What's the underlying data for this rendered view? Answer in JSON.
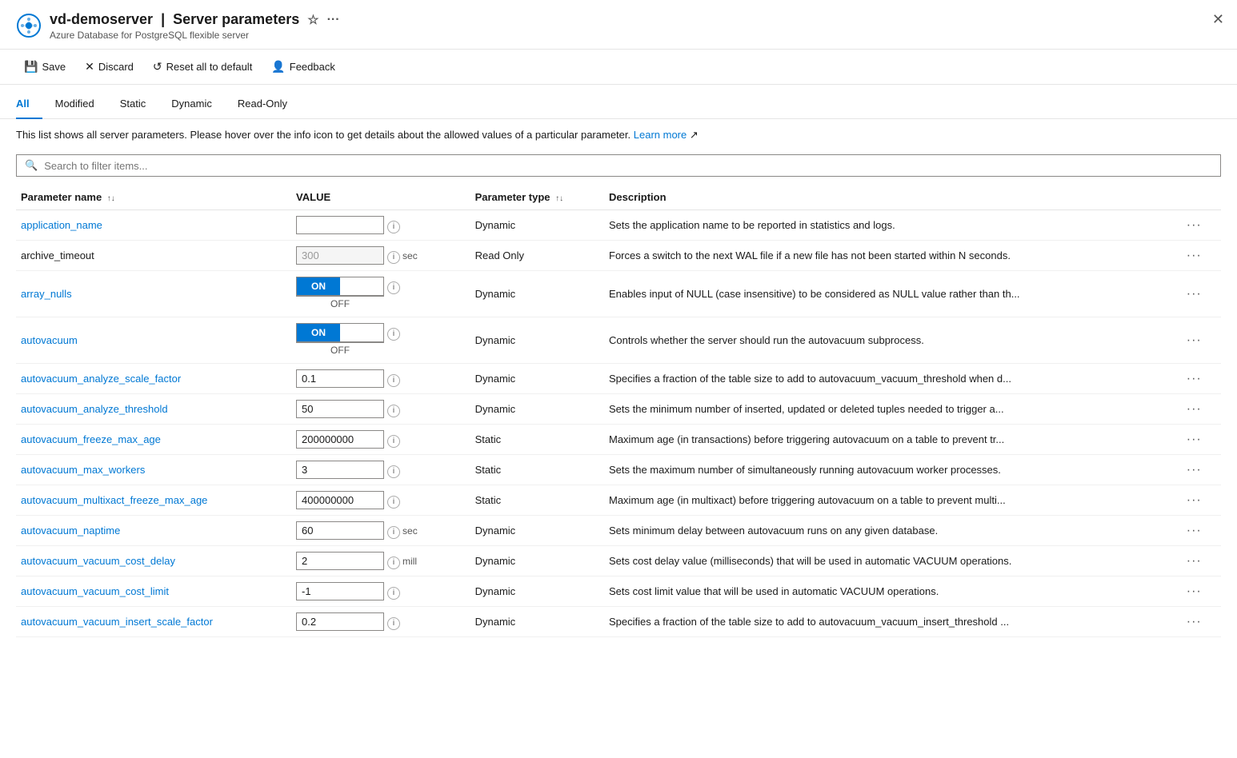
{
  "header": {
    "icon": "gear",
    "server_name": "vd-demoserver",
    "separator": "|",
    "page_title": "Server parameters",
    "subtitle": "Azure Database for PostgreSQL flexible server"
  },
  "toolbar": {
    "save_label": "Save",
    "discard_label": "Discard",
    "reset_label": "Reset all to default",
    "feedback_label": "Feedback"
  },
  "tabs": [
    {
      "id": "all",
      "label": "All",
      "active": true
    },
    {
      "id": "modified",
      "label": "Modified",
      "active": false
    },
    {
      "id": "static",
      "label": "Static",
      "active": false
    },
    {
      "id": "dynamic",
      "label": "Dynamic",
      "active": false
    },
    {
      "id": "readonly",
      "label": "Read-Only",
      "active": false
    }
  ],
  "info_text": "This list shows all server parameters. Please hover over the info icon to get details about the allowed values of a particular parameter.",
  "learn_more": "Learn more",
  "search_placeholder": "Search to filter items...",
  "table": {
    "columns": [
      {
        "id": "param_name",
        "label": "Parameter name",
        "sortable": true
      },
      {
        "id": "value",
        "label": "VALUE",
        "sortable": false
      },
      {
        "id": "param_type",
        "label": "Parameter type",
        "sortable": true
      },
      {
        "id": "description",
        "label": "Description",
        "sortable": false
      }
    ],
    "rows": [
      {
        "name": "application_name",
        "value": "",
        "value_type": "text",
        "unit": "",
        "param_type": "Dynamic",
        "description": "Sets the application name to be reported in statistics and logs."
      },
      {
        "name": "archive_timeout",
        "value": "300",
        "value_type": "text",
        "unit": "sec",
        "disabled": true,
        "param_type": "Read Only",
        "description": "Forces a switch to the next WAL file if a new file has not been started within N seconds."
      },
      {
        "name": "array_nulls",
        "value": "ON",
        "value_type": "toggle",
        "unit": "",
        "param_type": "Dynamic",
        "description": "Enables input of NULL (case insensitive) to be considered as NULL value rather than th..."
      },
      {
        "name": "autovacuum",
        "value": "ON",
        "value_type": "toggle",
        "unit": "",
        "param_type": "Dynamic",
        "description": "Controls whether the server should run the autovacuum subprocess."
      },
      {
        "name": "autovacuum_analyze_scale_factor",
        "value": "0.1",
        "value_type": "text",
        "unit": "",
        "param_type": "Dynamic",
        "description": "Specifies a fraction of the table size to add to autovacuum_vacuum_threshold when d..."
      },
      {
        "name": "autovacuum_analyze_threshold",
        "value": "50",
        "value_type": "text",
        "unit": "",
        "param_type": "Dynamic",
        "description": "Sets the minimum number of inserted, updated or deleted tuples needed to trigger a..."
      },
      {
        "name": "autovacuum_freeze_max_age",
        "value": "200000000",
        "value_type": "text",
        "unit": "",
        "param_type": "Static",
        "description": "Maximum age (in transactions) before triggering autovacuum on a table to prevent tr..."
      },
      {
        "name": "autovacuum_max_workers",
        "value": "3",
        "value_type": "text",
        "unit": "",
        "param_type": "Static",
        "description": "Sets the maximum number of simultaneously running autovacuum worker processes."
      },
      {
        "name": "autovacuum_multixact_freeze_max_age",
        "value": "400000000",
        "value_type": "text",
        "unit": "",
        "param_type": "Static",
        "description": "Maximum age (in multixact) before triggering autovacuum on a table to prevent multi..."
      },
      {
        "name": "autovacuum_naptime",
        "value": "60",
        "value_type": "text",
        "unit": "sec",
        "param_type": "Dynamic",
        "description": "Sets minimum delay between autovacuum runs on any given database."
      },
      {
        "name": "autovacuum_vacuum_cost_delay",
        "value": "2",
        "value_type": "text",
        "unit": "mill",
        "param_type": "Dynamic",
        "description": "Sets cost delay value (milliseconds) that will be used in automatic VACUUM operations."
      },
      {
        "name": "autovacuum_vacuum_cost_limit",
        "value": "-1",
        "value_type": "text",
        "unit": "",
        "param_type": "Dynamic",
        "description": "Sets cost limit value that will be used in automatic VACUUM operations."
      },
      {
        "name": "autovacuum_vacuum_insert_scale_factor",
        "value": "0.2",
        "value_type": "text",
        "unit": "",
        "param_type": "Dynamic",
        "description": "Specifies a fraction of the table size to add to autovacuum_vacuum_insert_threshold ..."
      }
    ]
  }
}
